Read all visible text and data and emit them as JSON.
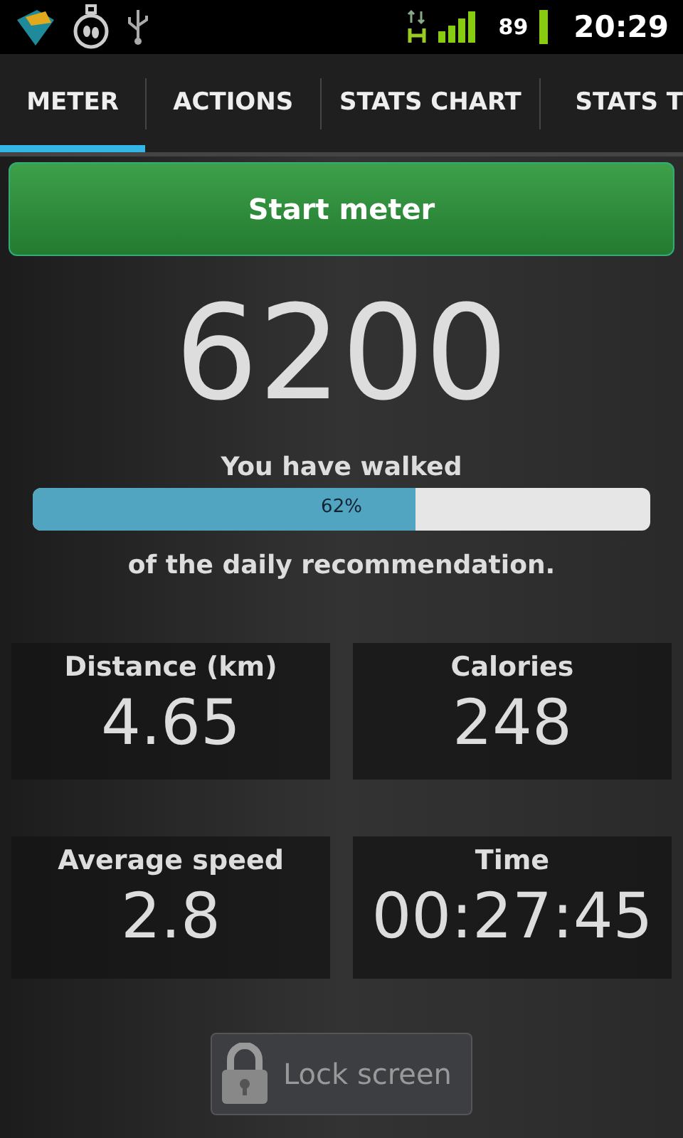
{
  "status_bar": {
    "battery": "89",
    "time": "20:29"
  },
  "tabs": [
    {
      "label": "METER",
      "selected": true
    },
    {
      "label": "ACTIONS",
      "selected": false
    },
    {
      "label": "STATS CHART",
      "selected": false
    },
    {
      "label": "STATS T",
      "selected": false
    }
  ],
  "start_button": {
    "label": "Start meter"
  },
  "steps": "6200",
  "progress": {
    "caption_top": "You have walked",
    "level": 0.62,
    "reading": "62%",
    "caption_bottom": "of the daily recommendation."
  },
  "stats": [
    {
      "label": "Distance (km)",
      "value": "4.65"
    },
    {
      "label": "Calories",
      "value": "248"
    },
    {
      "label": "Average speed",
      "value": "2.8"
    },
    {
      "label": "Time",
      "value": "00:27:45"
    }
  ],
  "lock_button": {
    "label": "Lock screen",
    "disabled": true
  }
}
